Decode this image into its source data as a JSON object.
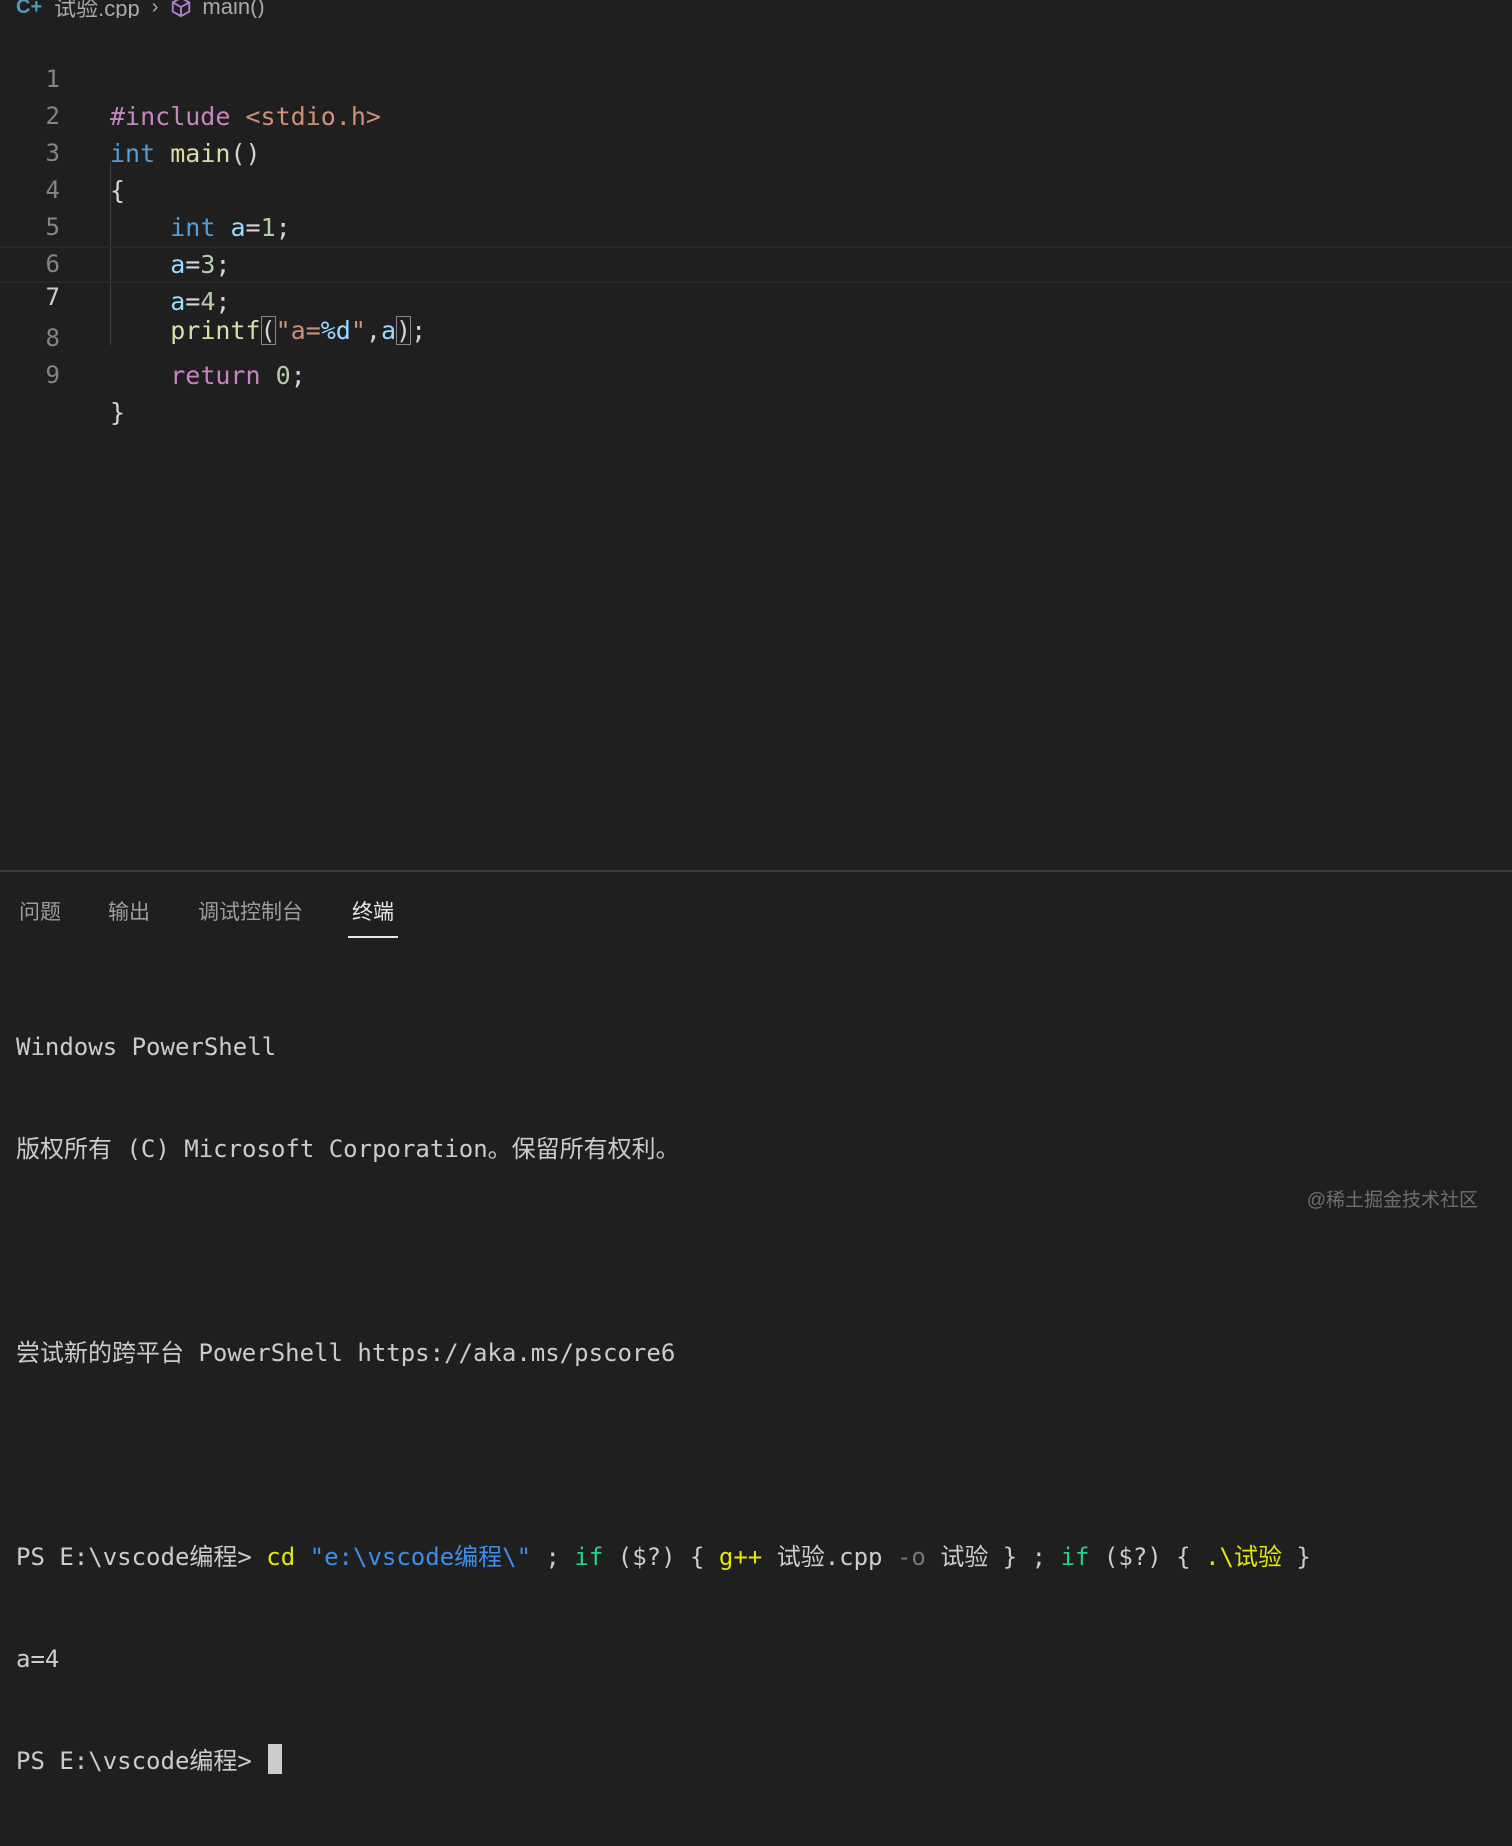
{
  "breadcrumb": {
    "file": "试验.cpp",
    "symbol": "main()"
  },
  "editor": {
    "current_line": 7,
    "line_numbers": [
      "1",
      "2",
      "3",
      "4",
      "5",
      "6",
      "7",
      "8",
      "9"
    ],
    "tokens": {
      "l1_pre": "#include",
      "l1_inc": "<stdio.h>",
      "l2_kw": "int",
      "l2_fn": "main",
      "l2_pun": "()",
      "l3_pun": "{",
      "l4_kw": "int",
      "l4_var": "a",
      "l4_eq": "=",
      "l4_num": "1",
      "l4_end": ";",
      "l5_var": "a",
      "l5_eq": "=",
      "l5_num": "3",
      "l5_end": ";",
      "l6_var": "a",
      "l6_eq": "=",
      "l6_num": "4",
      "l6_end": ";",
      "l7_fn": "printf",
      "l7_open": "(",
      "l7_str1": "\"a=",
      "l7_fmt": "%d",
      "l7_str2": "\"",
      "l7_comma": ",",
      "l7_var": "a",
      "l7_close": ")",
      "l7_end": ";",
      "l8_ctl": "return",
      "l8_num": "0",
      "l8_end": ";",
      "l9_pun": "}"
    }
  },
  "panel": {
    "tabs": [
      {
        "label": "问题"
      },
      {
        "label": "输出"
      },
      {
        "label": "调试控制台"
      },
      {
        "label": "终端",
        "active": true
      }
    ]
  },
  "terminal": {
    "line1": "Windows PowerShell",
    "line2": "版权所有 (C) Microsoft Corporation。保留所有权利。",
    "line3": "尝试新的跨平台 PowerShell https://aka.ms/pscore6",
    "cmd": {
      "prompt": "PS E:\\vscode编程> ",
      "cd": "cd",
      "path": "\"e:\\vscode编程\\\"",
      "sep1": " ; ",
      "if1": "if",
      "cond1": " ($?) { ",
      "gpp": "g++",
      "src": " 试验.cpp ",
      "flag": "-o",
      "out": " 试验 } ; ",
      "if2": "if",
      "cond2": " ($?) { ",
      "exe": ".\\试验",
      "tail": " }"
    },
    "output": "a=4",
    "prompt2": "PS E:\\vscode编程> "
  },
  "watermark": "@稀土掘金技术社区"
}
